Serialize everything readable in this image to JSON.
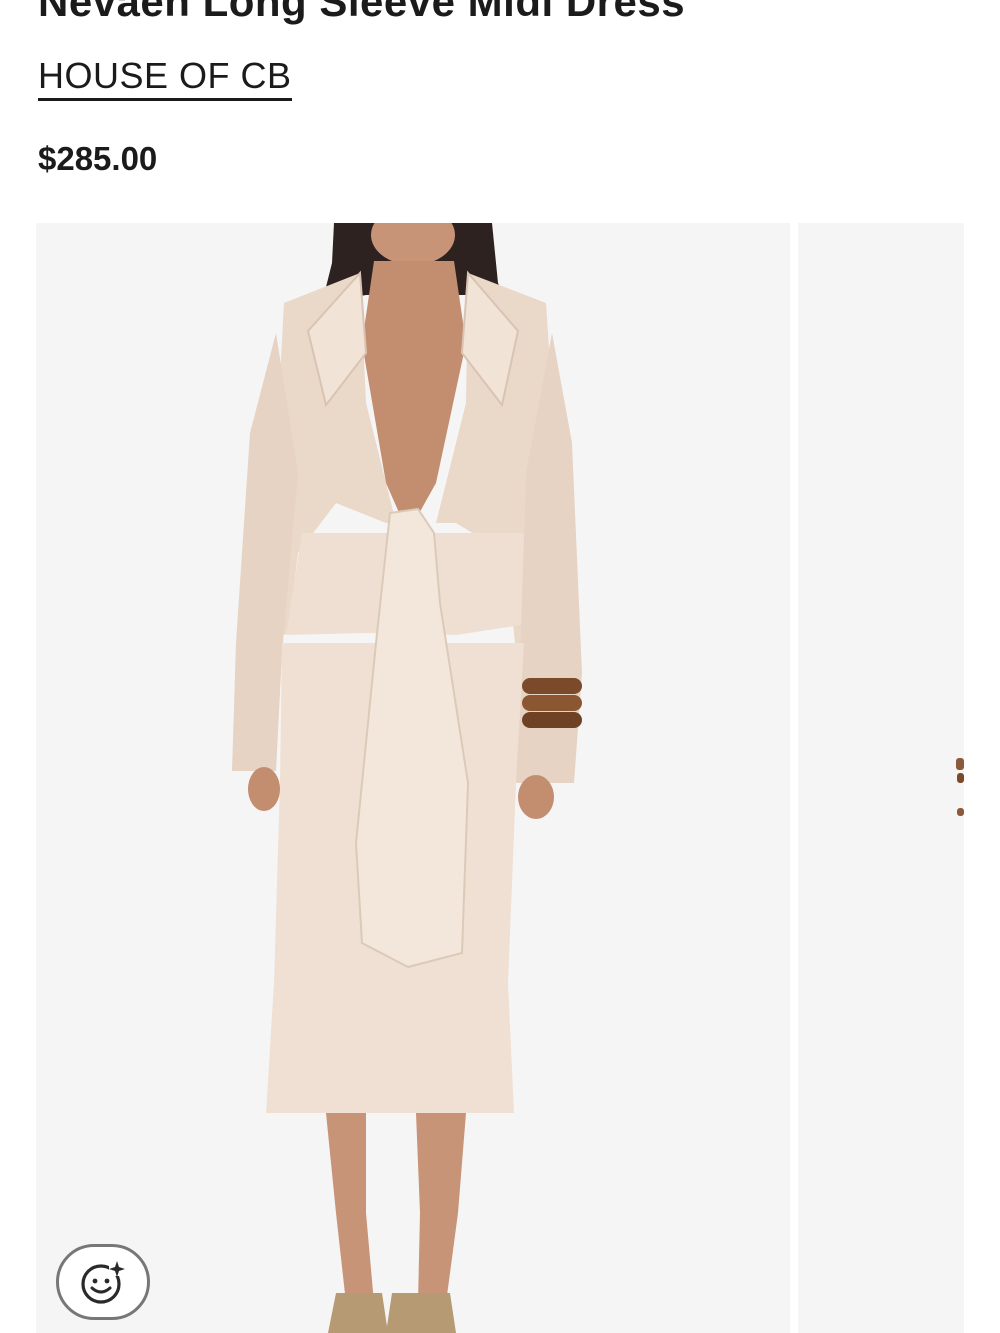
{
  "product": {
    "title": "Nevaeh Long Sleeve Midi Dress",
    "brand": "HOUSE OF CB",
    "price": "$285.00"
  },
  "gallery": {
    "background_color": "#f5f5f5",
    "dress_color": "#efe0d3",
    "slide_count_visible": 2
  },
  "try_on_button": {
    "icon": "face-sparkle-icon"
  }
}
